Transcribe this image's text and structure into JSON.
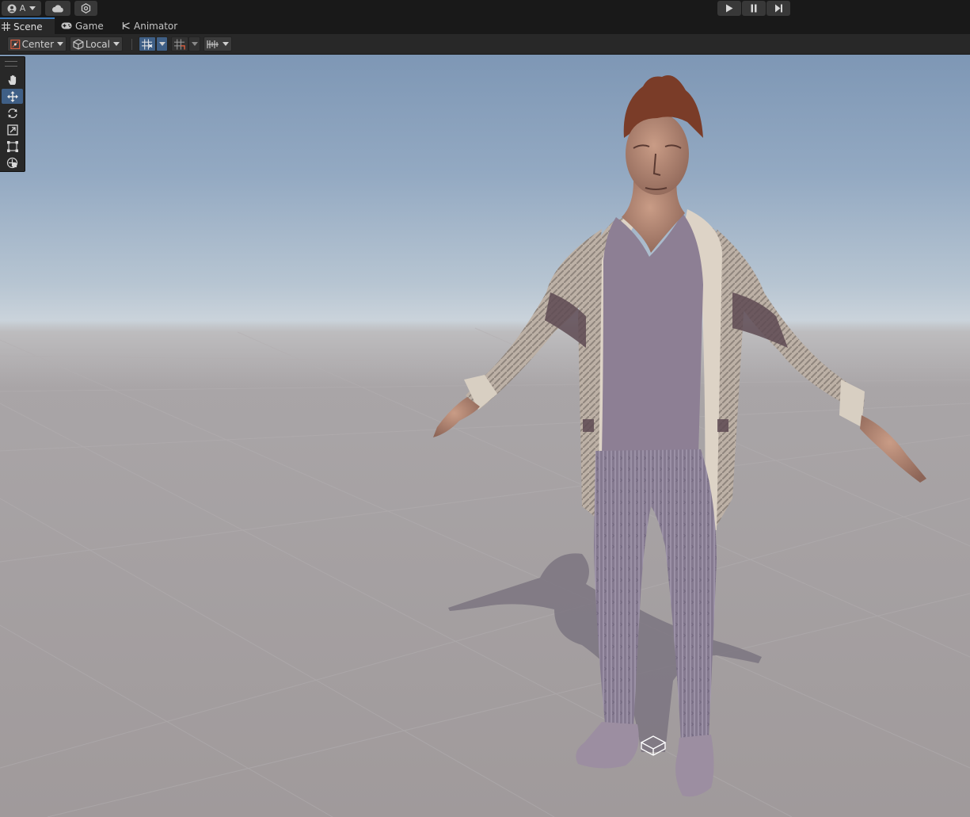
{
  "toolbar": {
    "account_label": "A",
    "account_icon": "account-icon",
    "cloud_icon": "cloud-icon",
    "collab_icon": "services-icon",
    "play_icon": "play-icon",
    "pause_icon": "pause-icon",
    "step_icon": "step-icon"
  },
  "tabs": [
    {
      "label": "Scene",
      "icon": "grid-icon",
      "active": true
    },
    {
      "label": "Game",
      "icon": "gamepad-icon",
      "active": false
    },
    {
      "label": "Animator",
      "icon": "animator-icon",
      "active": false
    }
  ],
  "scene_toolbar": {
    "pivot_mode": "Center",
    "pivot_rotation": "Local"
  },
  "tools": [
    "hand-tool",
    "move-tool",
    "rotate-tool",
    "scale-tool",
    "rect-tool",
    "transform-tool"
  ],
  "active_tool": "move-tool",
  "colors": {
    "accent": "#3f5f86",
    "tab_highlight": "#3a79bb",
    "panel": "#282828",
    "background": "#191919"
  }
}
